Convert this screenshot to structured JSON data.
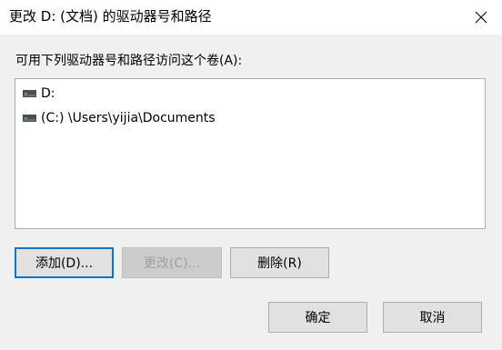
{
  "window": {
    "title": "更改 D: (文档) 的驱动器号和路径",
    "close_icon": "close-icon"
  },
  "dialog": {
    "prompt": "可用下列驱动器号和路径访问这个卷(A):",
    "items": [
      {
        "label": "D:",
        "icon": "drive-icon"
      },
      {
        "label": "(C:) \\Users\\yijia\\Documents",
        "icon": "drive-icon"
      }
    ]
  },
  "buttons": {
    "add": "添加(D)...",
    "change": "更改(C)...",
    "remove": "删除(R)",
    "ok": "确定",
    "cancel": "取消"
  },
  "colors": {
    "background": "#f0f0f0",
    "titlebar": "#ffffff",
    "focus_accent": "#0078d7",
    "drive_icon": "#4d4d4d",
    "drive_led": "#3cb371"
  }
}
